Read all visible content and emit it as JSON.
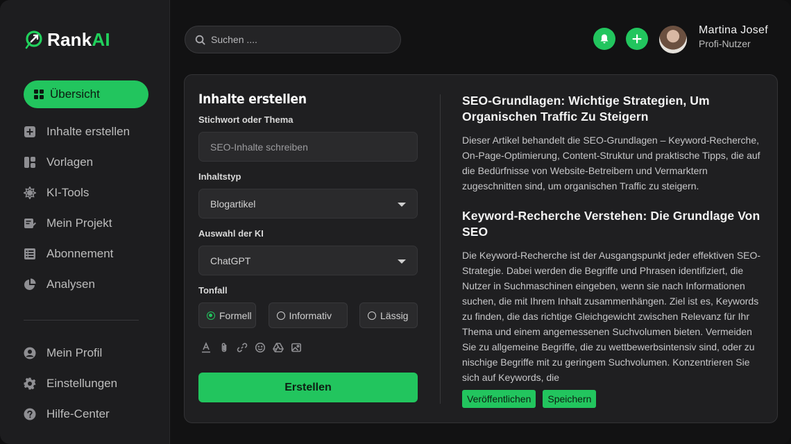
{
  "brand": {
    "name_part1": "Rank",
    "name_part2": "AI"
  },
  "sidebar": {
    "primary": [
      {
        "label": "Übersicht",
        "icon": "grid-icon",
        "active": true
      },
      {
        "label": "Inhalte erstellen",
        "icon": "plus-square-icon"
      },
      {
        "label": "Vorlagen",
        "icon": "layout-icon"
      },
      {
        "label": "KI-Tools",
        "icon": "ai-tools-icon"
      },
      {
        "label": "Mein Projekt",
        "icon": "edit-note-icon"
      },
      {
        "label": "Abonnement",
        "icon": "list-icon"
      },
      {
        "label": "Analysen",
        "icon": "pie-chart-icon"
      }
    ],
    "secondary": [
      {
        "label": "Mein Profil",
        "icon": "user-icon"
      },
      {
        "label": "Einstellungen",
        "icon": "gear-icon"
      },
      {
        "label": "Hilfe-Center",
        "icon": "help-icon"
      }
    ]
  },
  "header": {
    "search_placeholder": "Suchen ....",
    "user_name": "Martina  Josef",
    "user_role": "Profi-Nutzer"
  },
  "form": {
    "title": "Inhalte erstellen",
    "keyword_label": "Stichwort oder Thema",
    "keyword_placeholder": "SEO-Inhalte schreiben",
    "type_label": "Inhaltstyp",
    "type_value": "Blogartikel",
    "ai_label": "Auswahl der KI",
    "ai_value": "ChatGPT",
    "tone_label": "Tonfall",
    "tones": [
      {
        "label": "Formell",
        "selected": true
      },
      {
        "label": "Informativ",
        "selected": false
      },
      {
        "label": "Lässig",
        "selected": false
      }
    ],
    "create_label": "Erstellen"
  },
  "article": {
    "heading1": "SEO-Grundlagen: Wichtige Strategien, Um Organischen Traffic Zu Steigern",
    "para1": "Dieser Artikel behandelt die SEO-Grundlagen – Keyword-Recherche, On-Page-Optimierung, Content-Struktur und praktische Tipps, die auf die Bedürfnisse von Website-Betreibern und Vermarktern zugeschnitten sind, um organischen Traffic zu steigern.",
    "heading2": "Keyword-Recherche Verstehen: Die Grundlage Von SEO",
    "para2": "Die Keyword-Recherche ist der Ausgangspunkt jeder effektiven SEO-Strategie. Dabei werden die Begriffe und Phrasen identifiziert, die Nutzer in Suchmaschinen eingeben, wenn sie nach Informationen suchen, die mit Ihrem Inhalt zusammenhängen. Ziel ist es, Keywords zu finden, die das richtige Gleichgewicht zwischen Relevanz für Ihr Thema und einem angemessenen Suchvolumen bieten. Vermeiden Sie zu allgemeine Begriffe, die zu wettbewerbsintensiv sind, oder zu nischige Begriffe mit zu geringem Suchvolumen. Konzentrieren Sie sich auf Keywords, die",
    "publish_label": "Veröffentlichen",
    "save_label": "Speichern"
  },
  "colors": {
    "accent": "#22c55e",
    "background": "#121213",
    "panel": "#1f1f21"
  }
}
